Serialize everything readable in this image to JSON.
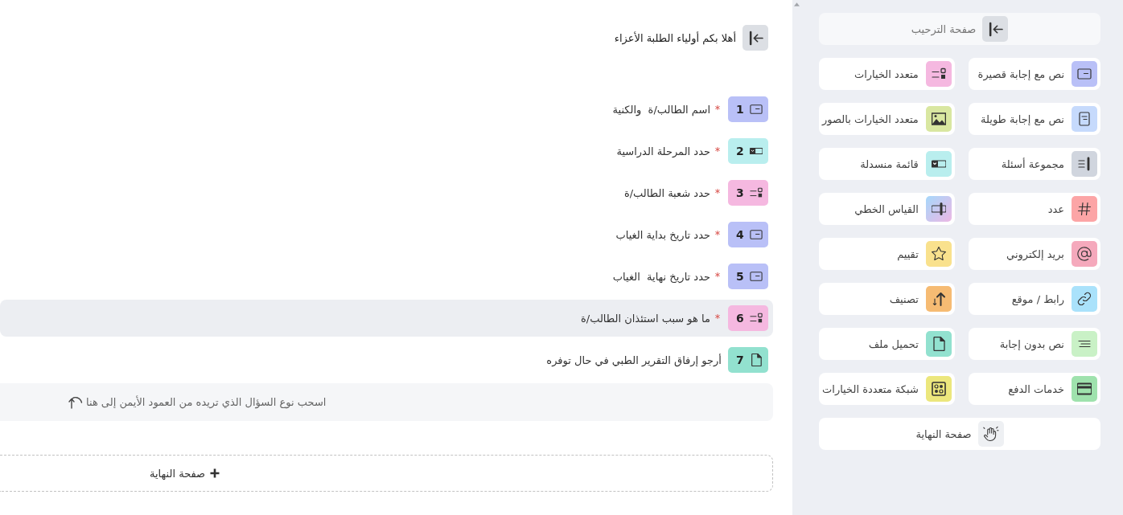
{
  "form": {
    "welcome": {
      "title": "أهلا بكم أولياء الطلبة الأعزاء"
    },
    "questions": [
      {
        "number": "1",
        "kind": "short-text",
        "label": "اسم الطالب/ة  والكنية",
        "required": true,
        "selected": false
      },
      {
        "number": "2",
        "kind": "dropdown",
        "label": "حدد المرحلة الدراسية",
        "required": true,
        "selected": false
      },
      {
        "number": "3",
        "kind": "multiple-choice",
        "label": "حدد شعبة الطالب/ة",
        "required": true,
        "selected": false
      },
      {
        "number": "4",
        "kind": "short-text",
        "label": "حدد تاريخ بداية الغياب",
        "required": true,
        "selected": false
      },
      {
        "number": "5",
        "kind": "short-text",
        "label": "حدد تاريخ نهاية  الغياب",
        "required": true,
        "selected": false
      },
      {
        "number": "6",
        "kind": "multiple-choice",
        "label": "ما هو سبب استئذان الطالب/ة",
        "required": true,
        "selected": true
      },
      {
        "number": "7",
        "kind": "file-upload",
        "label": "أرجو إرفاق التقرير الطبي في حال توفره",
        "required": false,
        "selected": false
      }
    ],
    "drop_zone": {
      "hint": "اسحب نوع السؤال الذي تريده من العمود الأيمن إلى هنا"
    },
    "add_end_page": {
      "label": "صفحة النهاية"
    }
  },
  "sidebar": {
    "welcome_page": {
      "label": "صفحة الترحيب",
      "disabled": true
    },
    "question_types": [
      {
        "label": "نص مع إجابة قصيرة",
        "kind": "short-text"
      },
      {
        "label": "متعدد الخيارات",
        "kind": "multiple-choice"
      },
      {
        "label": "نص مع إجابة طويلة",
        "kind": "long-text"
      },
      {
        "label": "متعدد الخيارات بالصور",
        "kind": "image-choice"
      },
      {
        "label": "مجموعة أسئلة",
        "kind": "question-group"
      },
      {
        "label": "قائمة منسدلة",
        "kind": "dropdown"
      },
      {
        "label": "عدد",
        "kind": "number"
      },
      {
        "label": "القياس الخطي",
        "kind": "linear-scale"
      },
      {
        "label": "بريد إلكتروني",
        "kind": "email"
      },
      {
        "label": "تقييم",
        "kind": "rating"
      },
      {
        "label": "رابط / موقع",
        "kind": "link"
      },
      {
        "label": "تصنيف",
        "kind": "ranking"
      },
      {
        "label": "نص بدون إجابة",
        "kind": "statement"
      },
      {
        "label": "تحميل ملف",
        "kind": "file-upload"
      },
      {
        "label": "خدمات الدفع",
        "kind": "payment"
      },
      {
        "label": "شبكة متعددة الخيارات",
        "kind": "choice-grid"
      }
    ],
    "end_page": {
      "label": "صفحة النهاية",
      "disabled": false
    }
  }
}
